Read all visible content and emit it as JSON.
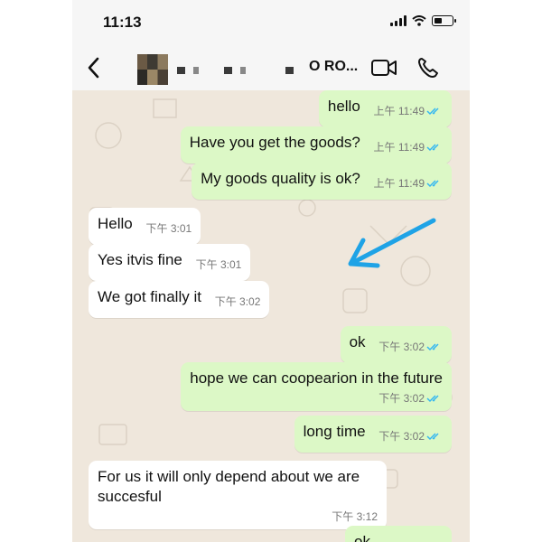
{
  "status_bar": {
    "time": "11:13"
  },
  "header": {
    "contact_name": "O RO..."
  },
  "messages": [
    {
      "text": "hello",
      "time": "上午 11:49",
      "dir": "out"
    },
    {
      "text": "Have you get the goods?",
      "time": "上午 11:49",
      "dir": "out"
    },
    {
      "text": "My goods quality is ok?",
      "time": "上午 11:49",
      "dir": "out"
    },
    {
      "text": "Hello",
      "time": "下午 3:01",
      "dir": "in"
    },
    {
      "text": "Yes itvis fine",
      "time": "下午 3:01",
      "dir": "in"
    },
    {
      "text": "We got finally it",
      "time": "下午 3:02",
      "dir": "in"
    },
    {
      "text": "ok",
      "time": "下午 3:02",
      "dir": "out"
    },
    {
      "text": "hope we can coopearion in the future",
      "time": "下午 3:02",
      "dir": "out"
    },
    {
      "text": "long time",
      "time": "下午 3:02",
      "dir": "out"
    },
    {
      "text": "For us it will only depend about we are succesful",
      "time": "下午 3:12",
      "dir": "in"
    },
    {
      "text": "ok",
      "dir": "out"
    }
  ],
  "colors": {
    "outgoing_bubble": "#dcf8c6",
    "incoming_bubble": "#ffffff",
    "read_ticks": "#34b7f1",
    "annotation_arrow": "#1fa3e6"
  },
  "icons": [
    "back-chevron-icon",
    "video-call-icon",
    "phone-call-icon",
    "signal-icon",
    "wifi-icon",
    "battery-icon",
    "read-ticks-icon"
  ]
}
